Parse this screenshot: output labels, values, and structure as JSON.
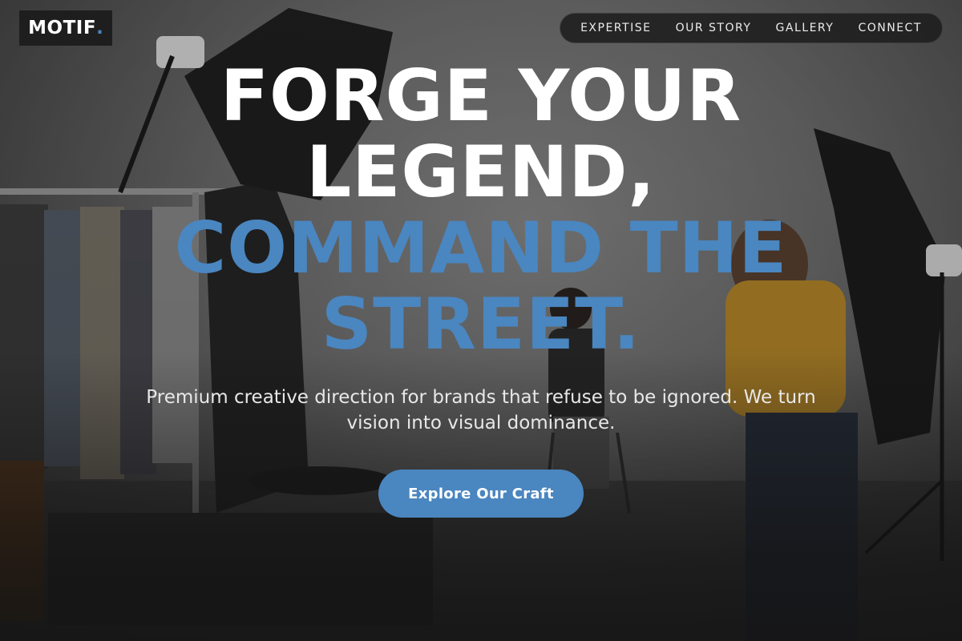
{
  "brand": {
    "name": "MOTIF",
    "dot": "."
  },
  "nav": {
    "items": [
      {
        "label": "EXPERTISE"
      },
      {
        "label": "OUR STORY"
      },
      {
        "label": "GALLERY"
      },
      {
        "label": "CONNECT"
      }
    ]
  },
  "hero": {
    "headline_white_1": "FORGE YOUR",
    "headline_white_2": "LEGEND,",
    "headline_blue_1": "COMMAND THE",
    "headline_blue_2": "STREET.",
    "subtitle": "Premium creative direction for brands that refuse to be ignored. We turn vision into visual dominance.",
    "cta_label": "Explore Our Craft",
    "background": "photo studio with clothing rack, softbox lights, seated model and photographer"
  },
  "colors": {
    "accent": "#4a86c0",
    "text": "#ffffff",
    "nav_bg": "#1e1e1e"
  }
}
